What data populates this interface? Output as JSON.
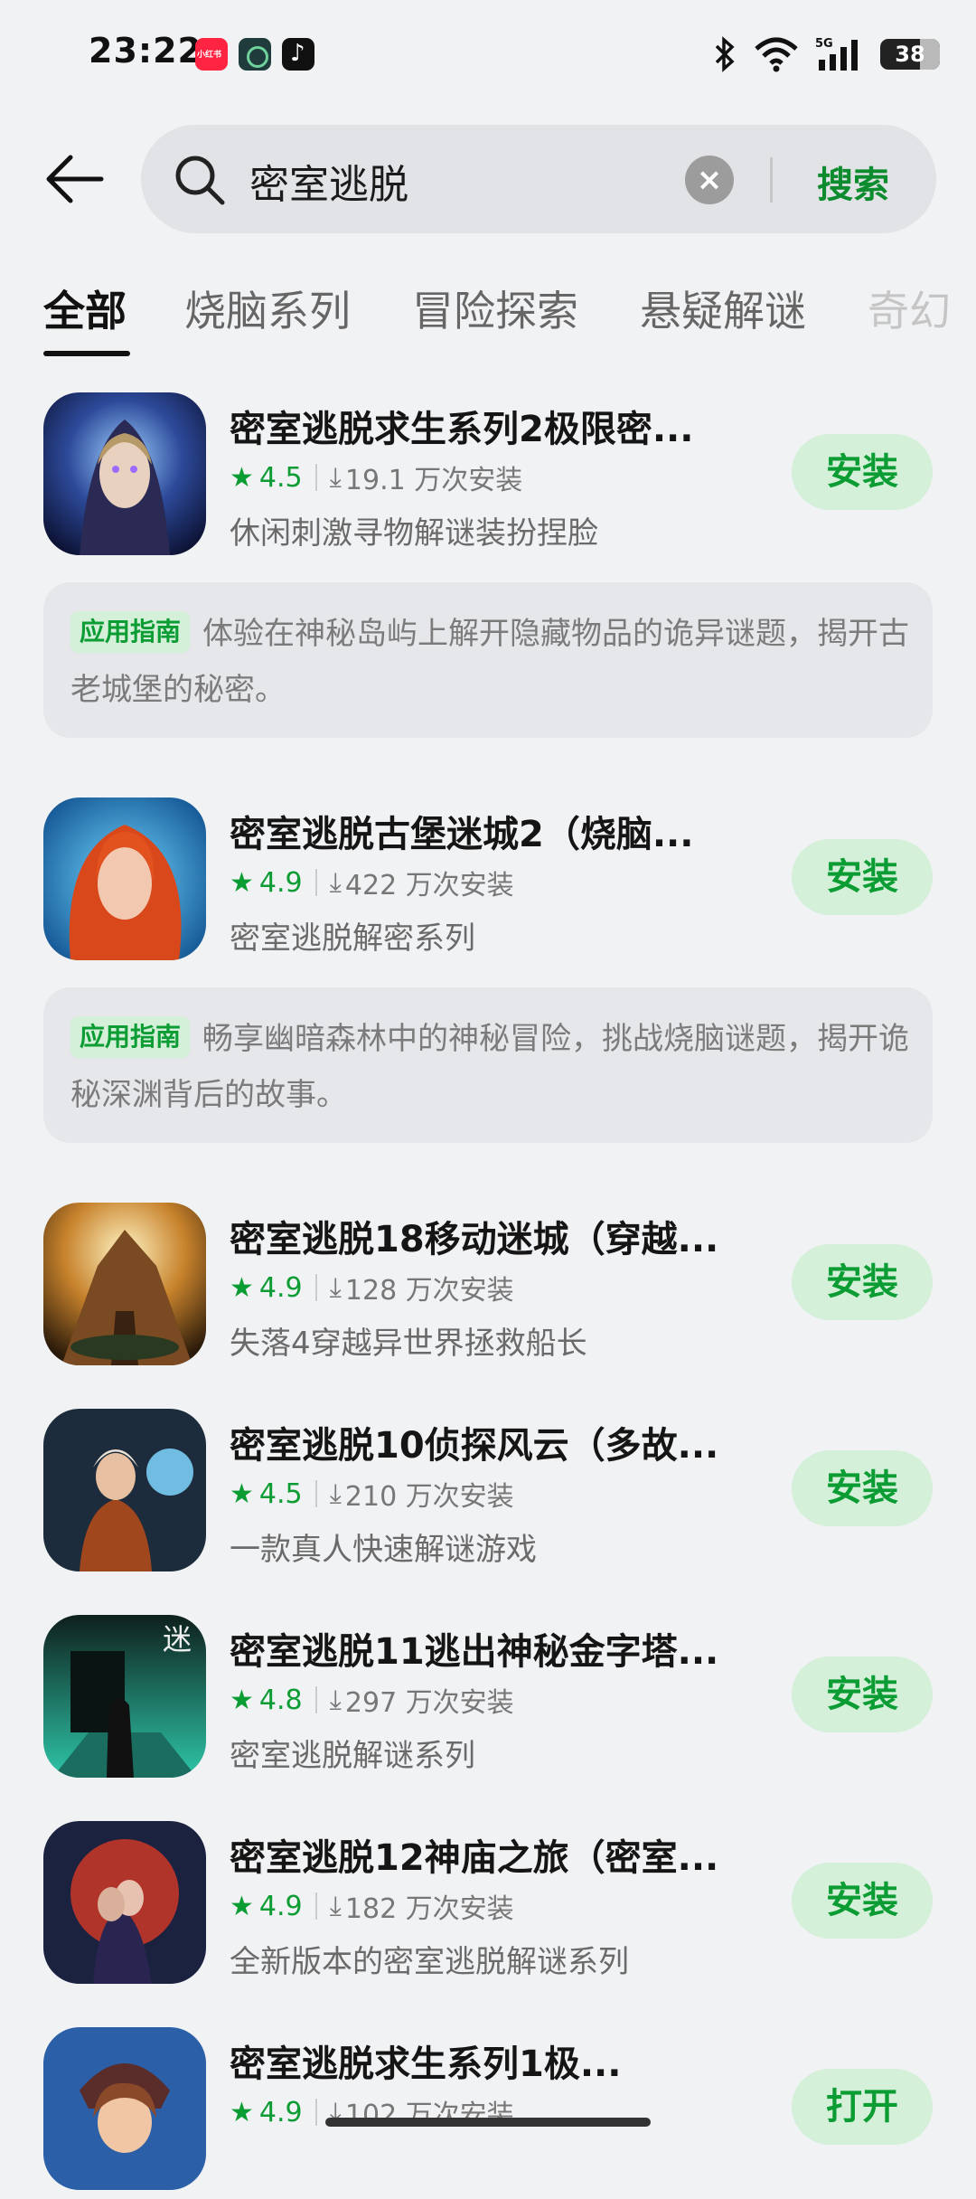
{
  "status_bar": {
    "time": "23:22",
    "battery": "38",
    "network": "5G"
  },
  "search": {
    "query": "密室逃脱",
    "button_label": "搜索"
  },
  "tabs": [
    "全部",
    "烧脑系列",
    "冒险探索",
    "悬疑解谜",
    "奇幻"
  ],
  "guide_badge": "应用指南",
  "apps": [
    {
      "title": "密室逃脱求生系列2极限密...",
      "rating": "4.5",
      "installs": "19.1 万次安装",
      "desc": "休闲刺激寻物解谜装扮捏脸",
      "action": "安装",
      "guide": "体验在神秘岛屿上解开隐藏物品的诡异谜题，揭开古老城堡的秘密。"
    },
    {
      "title": "密室逃脱古堡迷城2（烧脑...",
      "rating": "4.9",
      "installs": "422 万次安装",
      "desc": "密室逃脱解密系列",
      "action": "安装",
      "guide": "畅享幽暗森林中的神秘冒险，挑战烧脑谜题，揭开诡秘深渊背后的故事。"
    },
    {
      "title": "密室逃脱18移动迷城（穿越...",
      "rating": "4.9",
      "installs": "128 万次安装",
      "desc": "失落4穿越异世界拯救船长",
      "action": "安装"
    },
    {
      "title": "密室逃脱10侦探风云（多故...",
      "rating": "4.5",
      "installs": "210 万次安装",
      "desc": "一款真人快速解谜游戏",
      "action": "安装"
    },
    {
      "title": "密室逃脱11逃出神秘金字塔...",
      "rating": "4.8",
      "installs": "297 万次安装",
      "desc": "密室逃脱解谜系列",
      "action": "安装"
    },
    {
      "title": "密室逃脱12神庙之旅（密室...",
      "rating": "4.9",
      "installs": "182 万次安装",
      "desc": "全新版本的密室逃脱解谜系列",
      "action": "安装"
    },
    {
      "title": "密室逃脱求生系列1极...",
      "rating": "4.9",
      "installs": "102 万次安装",
      "desc": "",
      "action": "打开"
    }
  ]
}
